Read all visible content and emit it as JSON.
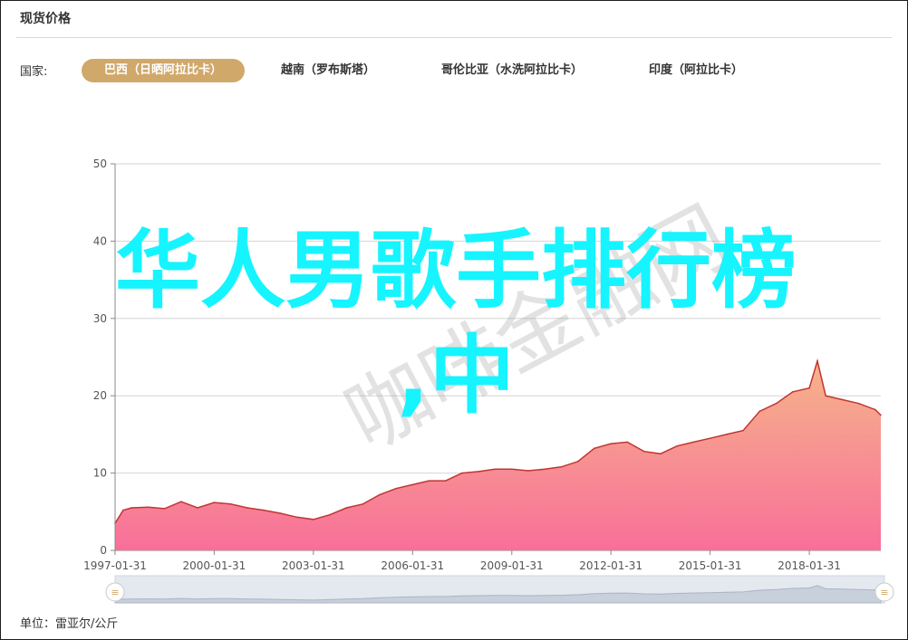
{
  "panel": {
    "title": "现货价格"
  },
  "filters": {
    "label": "国家:",
    "tabs": [
      {
        "label": "巴西（日晒阿拉比卡）",
        "active": true
      },
      {
        "label": "越南（罗布斯塔）",
        "active": false
      },
      {
        "label": "哥伦比亚（水洗阿拉比卡）",
        "active": false
      },
      {
        "label": "印度（阿拉比卡）",
        "active": false
      }
    ]
  },
  "overlay": {
    "line1": "华人男歌手排行榜",
    "line2": ",中"
  },
  "watermark": {
    "text": "咖啡金融网"
  },
  "footer": {
    "unit": "单位：雷亚尔/公斤"
  },
  "colors": {
    "line": "#c23531",
    "fill_top": "#f6b48a",
    "fill_bottom": "#f86f9a",
    "accent": "#d0a86a",
    "overlay": "#16f4ff"
  },
  "chart_data": {
    "type": "area",
    "title": "",
    "xlabel": "",
    "ylabel": "",
    "ylim": [
      0,
      50
    ],
    "yticks": [
      0,
      10,
      20,
      30,
      40,
      50
    ],
    "xlim": [
      "1997-01-31",
      "2020-03-31"
    ],
    "xticks": [
      "1997-01-31",
      "2000-01-31",
      "2003-01-31",
      "2006-01-31",
      "2009-01-31",
      "2012-01-31",
      "2015-01-31",
      "2018-01-31"
    ],
    "grid": true,
    "series": [
      {
        "x": [
          "1997-01-31",
          "1997-04-30",
          "1997-07-31",
          "1998-01-31",
          "1998-07-31",
          "1999-01-31",
          "1999-07-31",
          "2000-01-31",
          "2000-07-31",
          "2001-01-31",
          "2001-07-31",
          "2002-01-31",
          "2002-07-31",
          "2003-01-31",
          "2003-07-31",
          "2004-01-31",
          "2004-07-31",
          "2005-01-31",
          "2005-07-31",
          "2006-01-31",
          "2006-07-31",
          "2007-01-31",
          "2007-07-31",
          "2008-01-31",
          "2008-07-31",
          "2009-01-31",
          "2009-07-31",
          "2010-01-31",
          "2010-07-31",
          "2011-01-31",
          "2011-07-31",
          "2012-01-31",
          "2012-07-31",
          "2013-01-31",
          "2013-07-31",
          "2014-01-31",
          "2014-07-31",
          "2015-01-31",
          "2015-07-31",
          "2016-01-31",
          "2016-07-31",
          "2017-01-31",
          "2017-07-31",
          "2018-01-31",
          "2018-04-30",
          "2018-07-31",
          "2019-01-31",
          "2019-07-31",
          "2020-01-31",
          "2020-03-31"
        ],
        "values": [
          3.5,
          5.2,
          5.5,
          5.6,
          5.4,
          6.3,
          5.5,
          6.2,
          6.0,
          5.5,
          5.2,
          4.8,
          4.3,
          4.0,
          4.6,
          5.5,
          6.0,
          7.2,
          8.0,
          8.5,
          9.0,
          9.0,
          10.0,
          10.2,
          10.5,
          10.5,
          10.3,
          10.5,
          10.8,
          11.5,
          13.2,
          13.8,
          14.0,
          12.8,
          12.5,
          13.5,
          14.0,
          14.5,
          15.0,
          15.5,
          18.0,
          19.0,
          20.5,
          21.0,
          24.5,
          20.0,
          19.5,
          19.0,
          18.2,
          17.5
        ]
      }
    ]
  }
}
